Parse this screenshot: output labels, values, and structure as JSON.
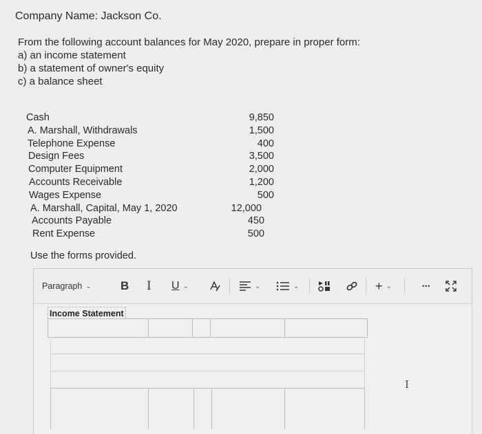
{
  "company_line": "Company Name:   Jackson Co.",
  "instructions": {
    "lead": "From the following account balances for May 2020, prepare in proper form:",
    "a": "a) an income statement",
    "b": "b) a statement of owner's equity",
    "c": "c) a balance sheet"
  },
  "accounts": [
    {
      "name": "Cash",
      "value": "9,850"
    },
    {
      "name": "A. Marshall,  Withdrawals",
      "value": "1,500"
    },
    {
      "name": "Telephone Expense",
      "value": "400"
    },
    {
      "name": "Design Fees",
      "value": "3,500"
    },
    {
      "name": "Computer Equipment",
      "value": "2,000"
    },
    {
      "name": "Accounts Receivable",
      "value": "1,200"
    },
    {
      "name": "Wages Expense",
      "value": "500"
    },
    {
      "name": "A. Marshall, Capital, May 1, 2020",
      "value": "12,000"
    },
    {
      "name": "Accounts Payable",
      "value": "450"
    },
    {
      "name": "Rent Expense",
      "value": "500"
    }
  ],
  "use_forms": "Use the forms provided.",
  "toolbar": {
    "paragraph_label": "Paragraph",
    "bold": "B",
    "italic": "I",
    "underline": "U",
    "more_label": "•••",
    "plus": "+"
  },
  "editor": {
    "table_title": "Income Statement"
  },
  "cursor_glyph": "I",
  "icons": [
    "chevron-down-icon",
    "text-color-icon",
    "align-icon",
    "list-icon",
    "media-icon",
    "link-icon",
    "insert-icon",
    "more-icon",
    "expand-icon",
    "text-cursor-icon"
  ]
}
